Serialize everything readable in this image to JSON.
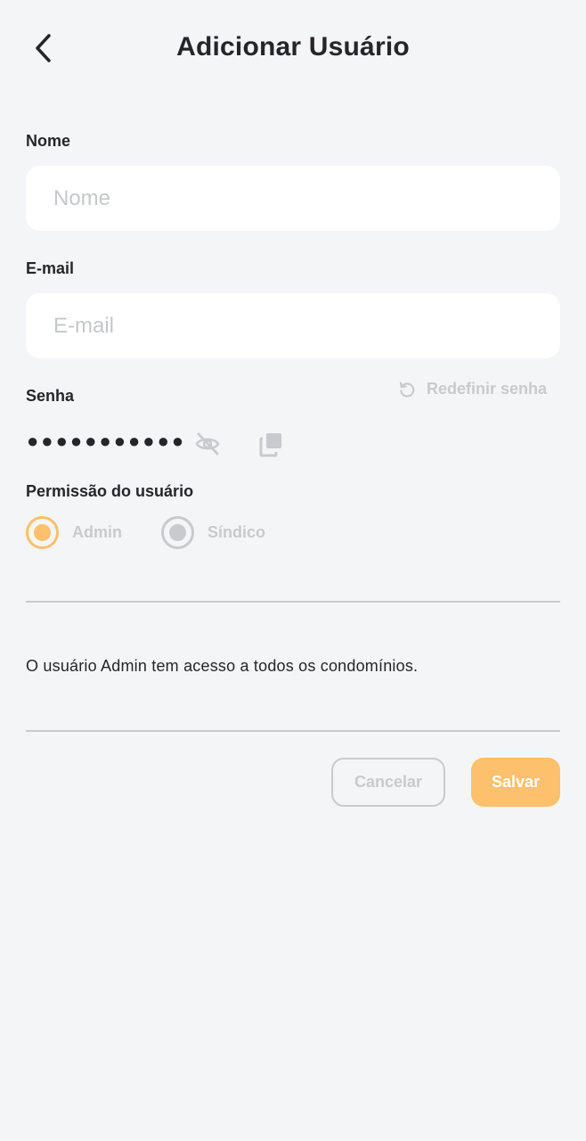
{
  "header": {
    "title": "Adicionar Usuário",
    "back_icon": "chevron-left-icon"
  },
  "form": {
    "name": {
      "label": "Nome",
      "placeholder": "Nome",
      "value": ""
    },
    "email": {
      "label": "E-mail",
      "placeholder": "E-mail",
      "value": ""
    },
    "password": {
      "label": "Senha",
      "masked_value": "●●●●●●●●●●●",
      "reset_label": "Redefinir senha",
      "reset_icon": "refresh-icon",
      "visibility_icon": "eye-off-icon",
      "copy_icon": "copy-icon"
    },
    "permission": {
      "label": "Permissão do usuário",
      "options": [
        {
          "label": "Admin",
          "selected": true
        },
        {
          "label": "Síndico",
          "selected": false
        }
      ]
    }
  },
  "info_text": "O usuário Admin tem acesso a todos os condomínios.",
  "actions": {
    "cancel_label": "Cancelar",
    "save_label": "Salvar"
  },
  "colors": {
    "accent": "#fdc06c",
    "background": "#f4f5f7",
    "muted": "#c9cacd",
    "text": "#26262a"
  }
}
